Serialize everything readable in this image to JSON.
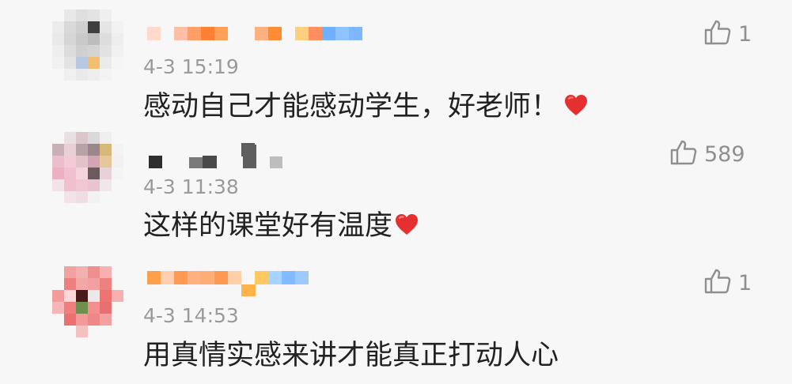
{
  "comments": [
    {
      "timestamp": "4-3 15:19",
      "text": "感动自己才能感动学生，好老师！",
      "has_heart": true,
      "likes": "1"
    },
    {
      "timestamp": "4-3 11:38",
      "text": "这样的课堂好有温度",
      "has_heart": true,
      "likes": "589"
    },
    {
      "timestamp": "4-3 14:53",
      "text": "用真情实感来讲才能真正打动人心",
      "has_heart": false,
      "likes": "1"
    }
  ],
  "icons": {
    "like": "thumbs-up-icon",
    "heart": "heart-icon",
    "avatar": "pixelated-avatar"
  },
  "colors": {
    "background": "#f7f7f7",
    "text": "#222222",
    "meta": "#9a9a9a",
    "like": "#8f8f8f",
    "heart": "#e5302f"
  }
}
